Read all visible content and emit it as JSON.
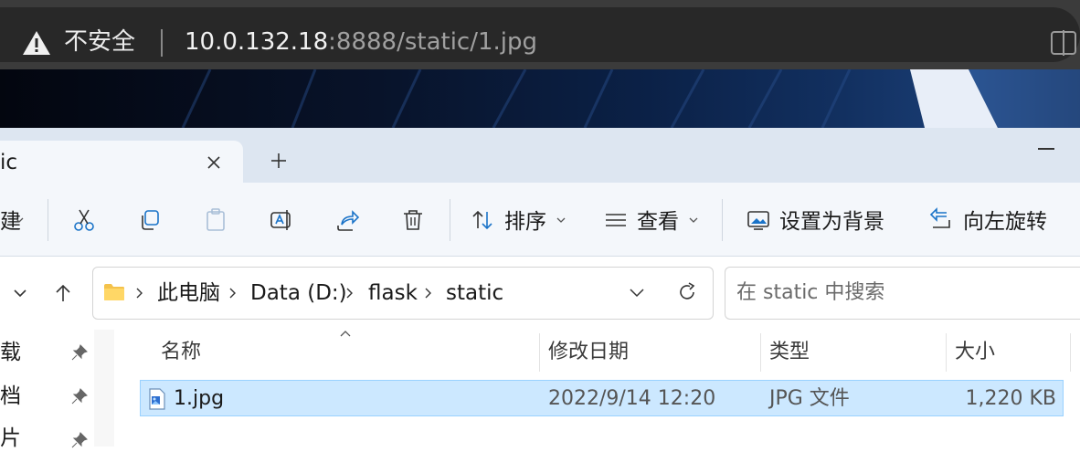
{
  "browser": {
    "security_label": "不安全",
    "url_host": "10.0.132.18",
    "url_rest": ":8888/static/1.jpg"
  },
  "explorer": {
    "tab_title": "ic",
    "toolbar": {
      "partial_label": "建",
      "sort_label": "排序",
      "view_label": "查看",
      "set_background_label": "设置为背景",
      "rotate_left_label": "向左旋转"
    },
    "breadcrumb": [
      "此电脑",
      "Data (D:)",
      "flask",
      "static"
    ],
    "search_placeholder": "在 static 中搜索",
    "nav_pane": [
      "载",
      "档",
      "片"
    ],
    "columns": {
      "name": "名称",
      "modified": "修改日期",
      "type": "类型",
      "size": "大小"
    },
    "files": [
      {
        "name": "1.jpg",
        "modified": "2022/9/14 12:20",
        "type": "JPG 文件",
        "size": "1,220 KB",
        "selected": true
      }
    ]
  },
  "colors": {
    "browser_chrome": "#282828",
    "tabstrip": "#dde6f1",
    "toolbar": "#f4f7fb",
    "selection_fill": "#cce8ff",
    "selection_border": "#99d1ff",
    "accent_blue": "#1a73c8"
  },
  "icons": [
    "warning-icon",
    "split-view-icon",
    "close-icon",
    "plus-icon",
    "minimize-icon",
    "cut-icon",
    "copy-icon",
    "paste-icon",
    "rename-icon",
    "share-icon",
    "delete-icon",
    "sort-icon",
    "view-icon",
    "set-background-icon",
    "rotate-left-icon",
    "chevron-down-icon",
    "arrow-up-icon",
    "folder-icon",
    "chevron-right-icon",
    "refresh-icon",
    "pin-icon",
    "image-file-icon"
  ]
}
